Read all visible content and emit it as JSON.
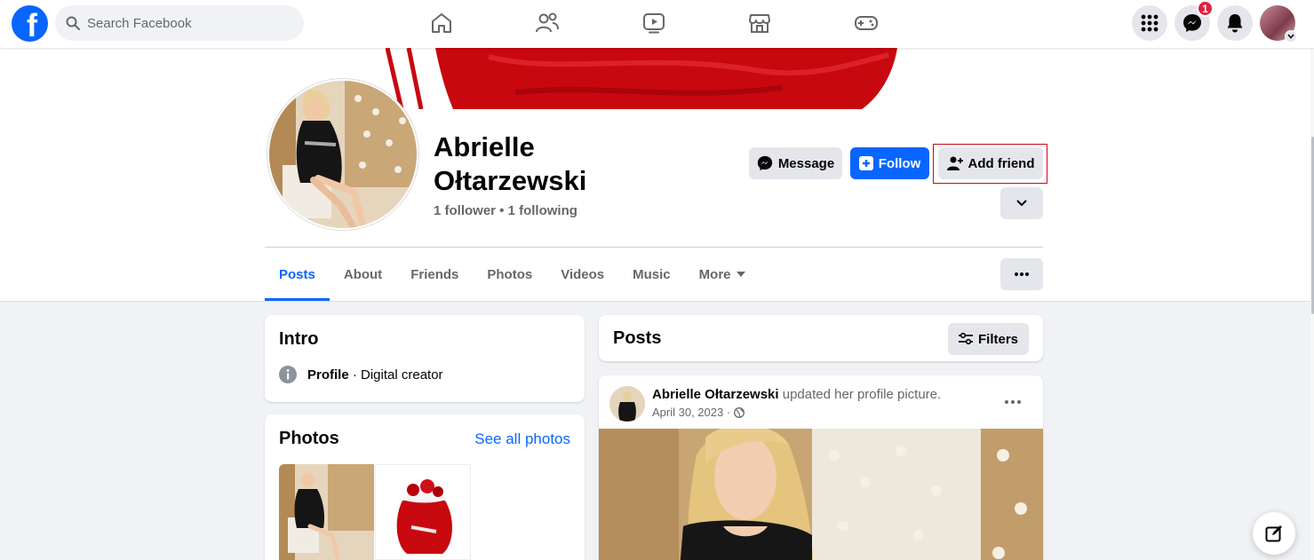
{
  "nav": {
    "search_placeholder": "Search Facebook",
    "logo_letter": "f",
    "messenger_badge": "1",
    "icons": [
      "home-icon",
      "friends-icon",
      "watch-icon",
      "marketplace-icon",
      "gaming-icon"
    ]
  },
  "profile": {
    "name_line1": "Abrielle",
    "name_line2": "Ołtarzewski",
    "followers": "1 follower • 1 following",
    "buttons": {
      "message": "Message",
      "follow": "Follow",
      "add_friend": "Add friend"
    }
  },
  "tabs": [
    "Posts",
    "About",
    "Friends",
    "Photos",
    "Videos",
    "Music",
    "More"
  ],
  "intro": {
    "title": "Intro",
    "profile_label": "Profile",
    "profile_desc": " · Digital creator"
  },
  "photos": {
    "title": "Photos",
    "see_all": "See all photos"
  },
  "posts_header": {
    "title": "Posts",
    "filters": "Filters"
  },
  "post": {
    "author": "Abrielle Ołtarzewski",
    "action": " updated her profile picture.",
    "date": "April 30, 2023 ·"
  },
  "colors": {
    "brand": "#0866ff",
    "badge": "#e41e3f",
    "highlight": "#d0021b"
  }
}
